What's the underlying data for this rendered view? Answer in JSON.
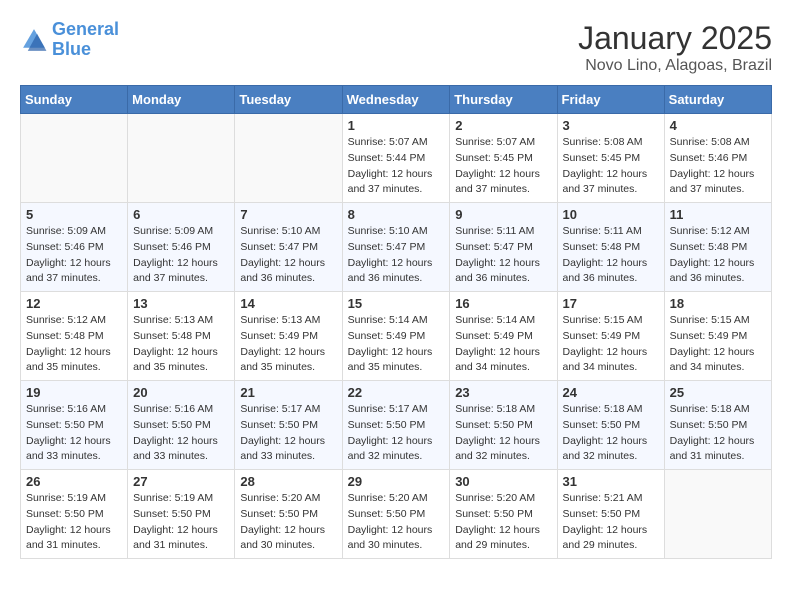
{
  "header": {
    "logo_line1": "General",
    "logo_line2": "Blue",
    "month": "January 2025",
    "location": "Novo Lino, Alagoas, Brazil"
  },
  "days_of_week": [
    "Sunday",
    "Monday",
    "Tuesday",
    "Wednesday",
    "Thursday",
    "Friday",
    "Saturday"
  ],
  "weeks": [
    [
      {
        "day": "",
        "sunrise": "",
        "sunset": "",
        "daylight": ""
      },
      {
        "day": "",
        "sunrise": "",
        "sunset": "",
        "daylight": ""
      },
      {
        "day": "",
        "sunrise": "",
        "sunset": "",
        "daylight": ""
      },
      {
        "day": "1",
        "sunrise": "Sunrise: 5:07 AM",
        "sunset": "Sunset: 5:44 PM",
        "daylight": "Daylight: 12 hours and 37 minutes."
      },
      {
        "day": "2",
        "sunrise": "Sunrise: 5:07 AM",
        "sunset": "Sunset: 5:45 PM",
        "daylight": "Daylight: 12 hours and 37 minutes."
      },
      {
        "day": "3",
        "sunrise": "Sunrise: 5:08 AM",
        "sunset": "Sunset: 5:45 PM",
        "daylight": "Daylight: 12 hours and 37 minutes."
      },
      {
        "day": "4",
        "sunrise": "Sunrise: 5:08 AM",
        "sunset": "Sunset: 5:46 PM",
        "daylight": "Daylight: 12 hours and 37 minutes."
      }
    ],
    [
      {
        "day": "5",
        "sunrise": "Sunrise: 5:09 AM",
        "sunset": "Sunset: 5:46 PM",
        "daylight": "Daylight: 12 hours and 37 minutes."
      },
      {
        "day": "6",
        "sunrise": "Sunrise: 5:09 AM",
        "sunset": "Sunset: 5:46 PM",
        "daylight": "Daylight: 12 hours and 37 minutes."
      },
      {
        "day": "7",
        "sunrise": "Sunrise: 5:10 AM",
        "sunset": "Sunset: 5:47 PM",
        "daylight": "Daylight: 12 hours and 36 minutes."
      },
      {
        "day": "8",
        "sunrise": "Sunrise: 5:10 AM",
        "sunset": "Sunset: 5:47 PM",
        "daylight": "Daylight: 12 hours and 36 minutes."
      },
      {
        "day": "9",
        "sunrise": "Sunrise: 5:11 AM",
        "sunset": "Sunset: 5:47 PM",
        "daylight": "Daylight: 12 hours and 36 minutes."
      },
      {
        "day": "10",
        "sunrise": "Sunrise: 5:11 AM",
        "sunset": "Sunset: 5:48 PM",
        "daylight": "Daylight: 12 hours and 36 minutes."
      },
      {
        "day": "11",
        "sunrise": "Sunrise: 5:12 AM",
        "sunset": "Sunset: 5:48 PM",
        "daylight": "Daylight: 12 hours and 36 minutes."
      }
    ],
    [
      {
        "day": "12",
        "sunrise": "Sunrise: 5:12 AM",
        "sunset": "Sunset: 5:48 PM",
        "daylight": "Daylight: 12 hours and 35 minutes."
      },
      {
        "day": "13",
        "sunrise": "Sunrise: 5:13 AM",
        "sunset": "Sunset: 5:48 PM",
        "daylight": "Daylight: 12 hours and 35 minutes."
      },
      {
        "day": "14",
        "sunrise": "Sunrise: 5:13 AM",
        "sunset": "Sunset: 5:49 PM",
        "daylight": "Daylight: 12 hours and 35 minutes."
      },
      {
        "day": "15",
        "sunrise": "Sunrise: 5:14 AM",
        "sunset": "Sunset: 5:49 PM",
        "daylight": "Daylight: 12 hours and 35 minutes."
      },
      {
        "day": "16",
        "sunrise": "Sunrise: 5:14 AM",
        "sunset": "Sunset: 5:49 PM",
        "daylight": "Daylight: 12 hours and 34 minutes."
      },
      {
        "day": "17",
        "sunrise": "Sunrise: 5:15 AM",
        "sunset": "Sunset: 5:49 PM",
        "daylight": "Daylight: 12 hours and 34 minutes."
      },
      {
        "day": "18",
        "sunrise": "Sunrise: 5:15 AM",
        "sunset": "Sunset: 5:49 PM",
        "daylight": "Daylight: 12 hours and 34 minutes."
      }
    ],
    [
      {
        "day": "19",
        "sunrise": "Sunrise: 5:16 AM",
        "sunset": "Sunset: 5:50 PM",
        "daylight": "Daylight: 12 hours and 33 minutes."
      },
      {
        "day": "20",
        "sunrise": "Sunrise: 5:16 AM",
        "sunset": "Sunset: 5:50 PM",
        "daylight": "Daylight: 12 hours and 33 minutes."
      },
      {
        "day": "21",
        "sunrise": "Sunrise: 5:17 AM",
        "sunset": "Sunset: 5:50 PM",
        "daylight": "Daylight: 12 hours and 33 minutes."
      },
      {
        "day": "22",
        "sunrise": "Sunrise: 5:17 AM",
        "sunset": "Sunset: 5:50 PM",
        "daylight": "Daylight: 12 hours and 32 minutes."
      },
      {
        "day": "23",
        "sunrise": "Sunrise: 5:18 AM",
        "sunset": "Sunset: 5:50 PM",
        "daylight": "Daylight: 12 hours and 32 minutes."
      },
      {
        "day": "24",
        "sunrise": "Sunrise: 5:18 AM",
        "sunset": "Sunset: 5:50 PM",
        "daylight": "Daylight: 12 hours and 32 minutes."
      },
      {
        "day": "25",
        "sunrise": "Sunrise: 5:18 AM",
        "sunset": "Sunset: 5:50 PM",
        "daylight": "Daylight: 12 hours and 31 minutes."
      }
    ],
    [
      {
        "day": "26",
        "sunrise": "Sunrise: 5:19 AM",
        "sunset": "Sunset: 5:50 PM",
        "daylight": "Daylight: 12 hours and 31 minutes."
      },
      {
        "day": "27",
        "sunrise": "Sunrise: 5:19 AM",
        "sunset": "Sunset: 5:50 PM",
        "daylight": "Daylight: 12 hours and 31 minutes."
      },
      {
        "day": "28",
        "sunrise": "Sunrise: 5:20 AM",
        "sunset": "Sunset: 5:50 PM",
        "daylight": "Daylight: 12 hours and 30 minutes."
      },
      {
        "day": "29",
        "sunrise": "Sunrise: 5:20 AM",
        "sunset": "Sunset: 5:50 PM",
        "daylight": "Daylight: 12 hours and 30 minutes."
      },
      {
        "day": "30",
        "sunrise": "Sunrise: 5:20 AM",
        "sunset": "Sunset: 5:50 PM",
        "daylight": "Daylight: 12 hours and 29 minutes."
      },
      {
        "day": "31",
        "sunrise": "Sunrise: 5:21 AM",
        "sunset": "Sunset: 5:50 PM",
        "daylight": "Daylight: 12 hours and 29 minutes."
      },
      {
        "day": "",
        "sunrise": "",
        "sunset": "",
        "daylight": ""
      }
    ]
  ]
}
